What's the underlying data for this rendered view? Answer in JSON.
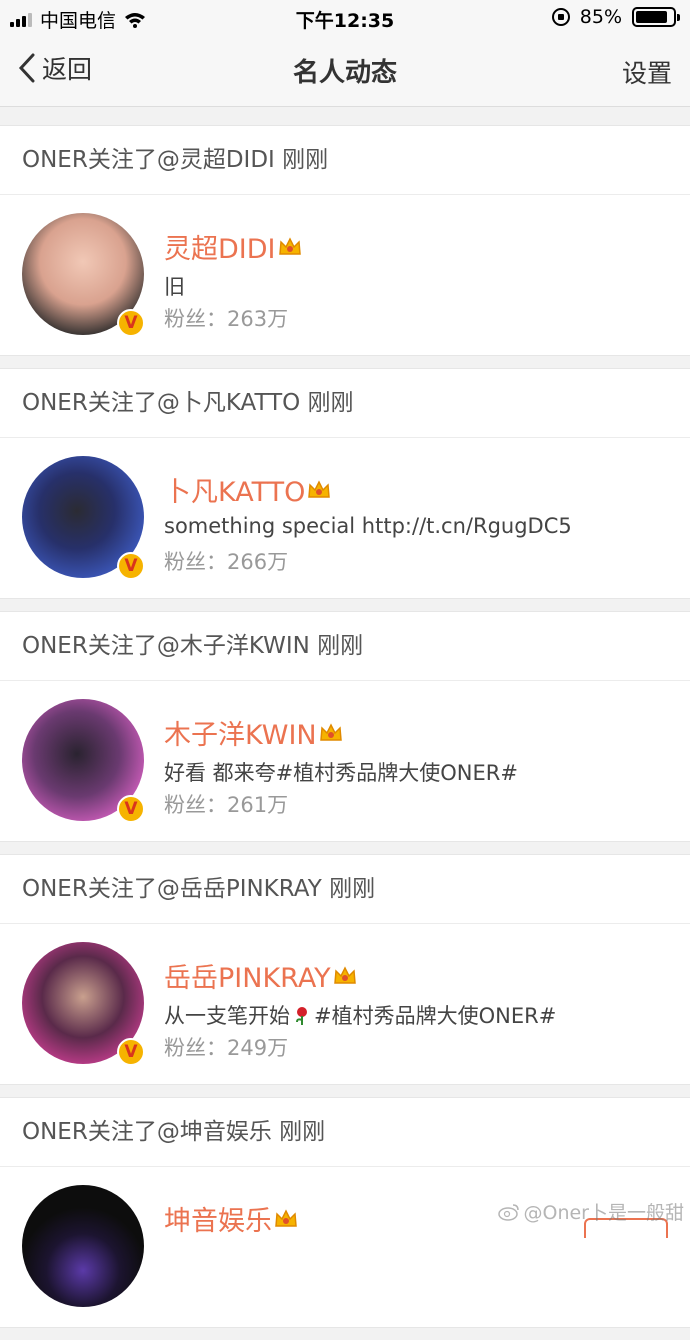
{
  "status_bar": {
    "carrier": "中国电信",
    "time": "下午12:35",
    "battery": "85%",
    "battery_level": 0.85
  },
  "nav": {
    "back_label": "返回",
    "title": "名人动态",
    "settings_label": "设置"
  },
  "feed": [
    {
      "header": "ONER关注了@灵超DIDI 刚刚",
      "name": "灵超DIDI",
      "desc": "旧",
      "fans": "粉丝：263万",
      "avatar_bg": "#e6b7a7"
    },
    {
      "header": "ONER关注了@卜凡KATTO 刚刚",
      "name": "卜凡KATTO",
      "desc": "something special http://t.cn/RgugDC5",
      "fans": "粉丝：266万",
      "avatar_bg": "#3b56b8"
    },
    {
      "header": "ONER关注了@木子洋KWIN 刚刚",
      "name": "木子洋KWIN",
      "desc": "好看 都来夸#植村秀品牌大使ONER#",
      "fans": "粉丝：261万",
      "avatar_bg": "#d45fc0"
    },
    {
      "header": "ONER关注了@岳岳PINKRAY 刚刚",
      "name": "岳岳PINKRAY",
      "desc_before": "从一支笔开始",
      "desc_after": "#植村秀品牌大使ONER#",
      "fans": "粉丝：249万",
      "avatar_bg": "#c63d8f"
    },
    {
      "header": "ONER关注了@坤音娱乐 刚刚",
      "name": "坤音娱乐",
      "avatar_bg": "#111111"
    }
  ],
  "watermark": "@Oner卜是一般甜",
  "colors": {
    "name": "#eb7350",
    "badge": "#f6b300"
  }
}
